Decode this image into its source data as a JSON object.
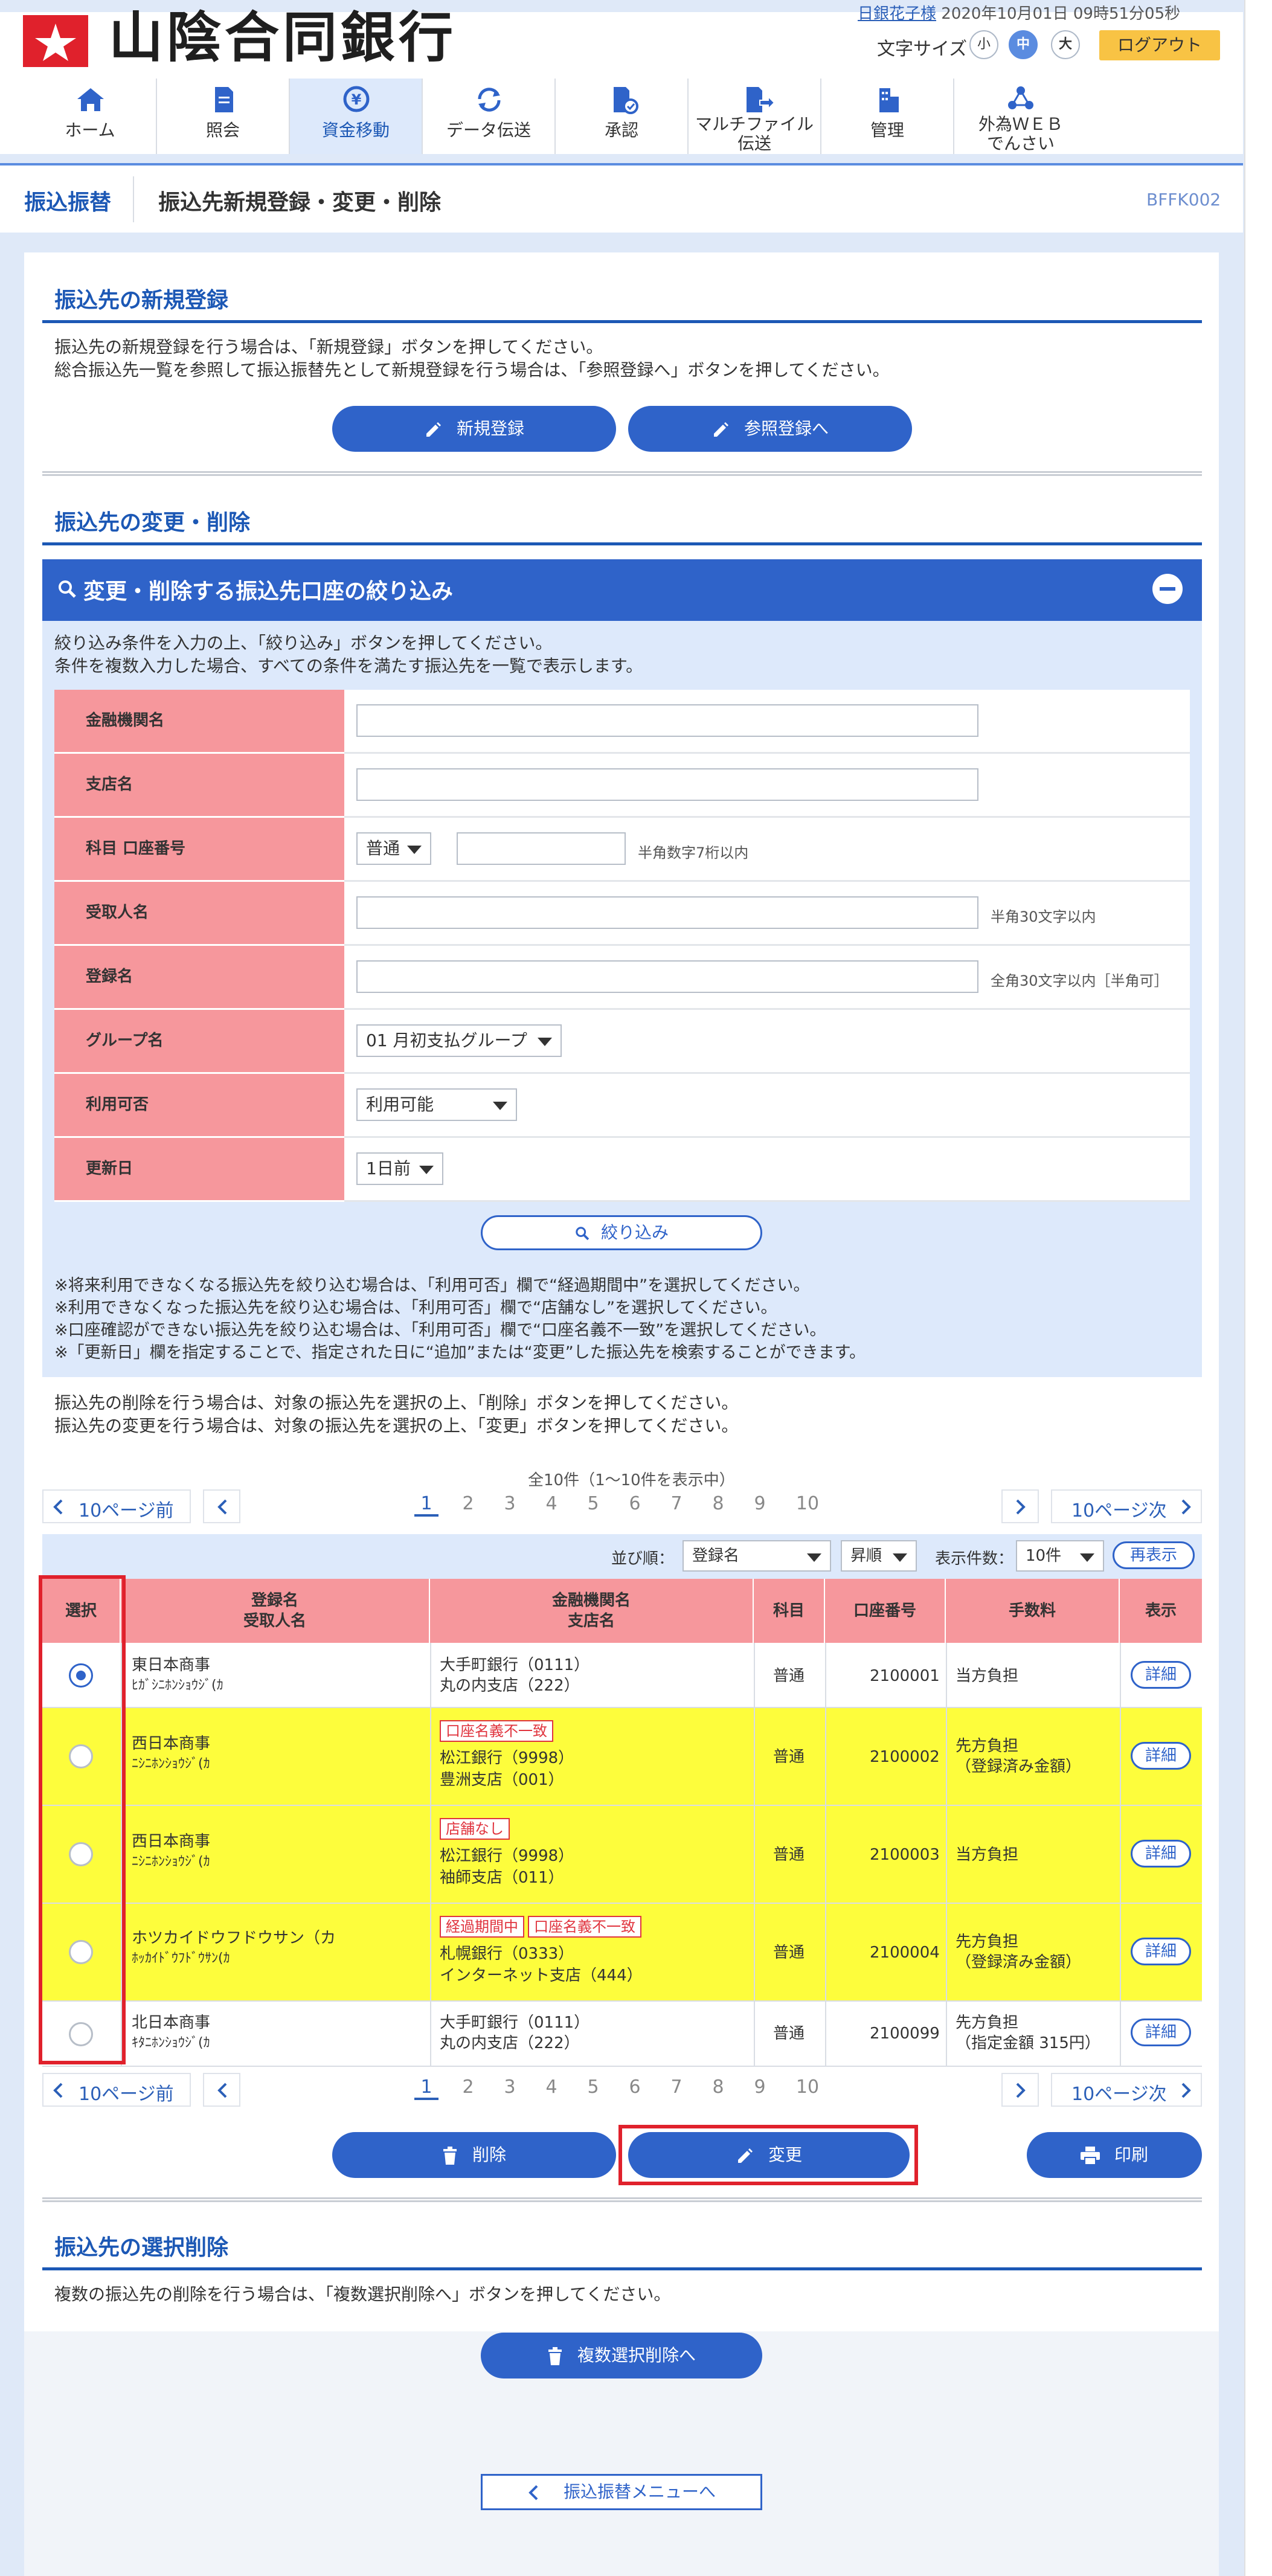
{
  "header": {
    "bank_name": "山陰合同銀行",
    "user_line": "2020年10月01日 09時51分05秒",
    "user_name": "日銀花子様",
    "font_size_label": "文字サイズ",
    "font_sizes": [
      "小",
      "中",
      "大"
    ],
    "logout": "ログアウト",
    "nav": [
      {
        "label": "ホーム",
        "icon": "home-icon"
      },
      {
        "label": "照会",
        "icon": "document-icon"
      },
      {
        "label": "資金移動",
        "icon": "yen-transfer-icon"
      },
      {
        "label": "データ伝送",
        "icon": "sync-icon"
      },
      {
        "label": "承認",
        "icon": "approve-document-icon"
      },
      {
        "label": "マルチファイル伝送",
        "label2": "伝送",
        "label1": "マルチファイル",
        "icon": "file-send-icon"
      },
      {
        "label": "管理",
        "icon": "building-icon"
      },
      {
        "label1": "外為ＷＥＢ",
        "label2": "でんさい",
        "icon": "network-icon"
      }
    ]
  },
  "titlebar": {
    "crumb": "振込振替",
    "title": "振込先新規登録・変更・削除",
    "screen_id": "BFFK002"
  },
  "new_section": {
    "heading": "振込先の新規登録",
    "text1": "振込先の新規登録を行う場合は、「新規登録」ボタンを押してください。",
    "text2": "総合振込先一覧を参照して振込振替先として新規登録を行う場合は、「参照登録へ」ボタンを押してください。",
    "btn_new": "新規登録",
    "btn_ref": "参照登録へ"
  },
  "change_section": {
    "heading": "振込先の変更・削除",
    "filter_title": "変更・削除する振込先口座の絞り込み",
    "filter_text1": "絞り込み条件を入力の上、「絞り込み」ボタンを押してください。",
    "filter_text2": "条件を複数入力した場合、すべての条件を満たす振込先を一覧で表示します。",
    "fields": {
      "bank": "金融機関名",
      "branch": "支店名",
      "account": "科目 口座番号",
      "account_type": "普通",
      "account_hint": "半角数字7桁以内",
      "payee": "受取人名",
      "payee_hint": "半角30文字以内",
      "reg_name": "登録名",
      "reg_hint": "全角30文字以内［半角可］",
      "group": "グループ名",
      "group_value": "01 月初支払グループ",
      "usable": "利用可否",
      "usable_value": "利用可能",
      "updated": "更新日",
      "updated_value": "1日前"
    },
    "filter_btn": "絞り込み",
    "notes": [
      "※将来利用できなくなる振込先を絞り込む場合は、「利用可否」欄で“経過期間中”を選択してください。",
      "※利用できなくなった振込先を絞り込む場合は、「利用可否」欄で“店舗なし”を選択してください。",
      "※口座確認ができない振込先を絞り込む場合は、「利用可否」欄で“口座名義不一致”を選択してください。",
      "※「更新日」欄を指定することで、指定された日に“追加”または“変更”した振込先を検索することができます。"
    ],
    "instr1": "振込先の削除を行う場合は、対象の振込先を選択の上、「削除」ボタンを押してください。",
    "instr2": "振込先の変更を行う場合は、対象の振込先を選択の上、「変更」ボタンを押してください。"
  },
  "pagination": {
    "summary": "全10件（1～10件を表示中）",
    "prev10": "10ページ前",
    "next10": "10ページ次",
    "pages": [
      "1",
      "2",
      "3",
      "4",
      "5",
      "6",
      "7",
      "8",
      "9",
      "10"
    ],
    "current": "1"
  },
  "toolbar": {
    "sort_label": "並び順：",
    "sort_value": "登録名",
    "order_value": "昇順",
    "count_label": "表示件数：",
    "count_value": "10件",
    "redisplay": "再表示"
  },
  "table": {
    "headers": {
      "select": "選択",
      "name1": "登録名",
      "name2": "受取人名",
      "bank1": "金融機関名",
      "bank2": "支店名",
      "type": "科目",
      "account": "口座番号",
      "fee": "手数料",
      "show": "表示"
    },
    "rows": [
      {
        "name": "東日本商事",
        "kana": "ﾋｶﾞｼﾆﾎﾝｼｮｳｼﾞ(ｶ",
        "tags": [],
        "bank": "大手町銀行（0111）",
        "branch": "丸の内支店（222）",
        "type": "普通",
        "account": "2100001",
        "fee1": "当方負担",
        "fee2": "",
        "detail": "詳細",
        "selected": true
      },
      {
        "name": "西日本商事",
        "kana": "ﾆｼﾆﾎﾝｼｮｳｼﾞ(ｶ",
        "tags": [
          "口座名義不一致"
        ],
        "bank": "松江銀行（9998）",
        "branch": "豊洲支店（001）",
        "type": "普通",
        "account": "2100002",
        "fee1": "先方負担",
        "fee2": "（登録済み金額）",
        "detail": "詳細",
        "selected": false
      },
      {
        "name": "西日本商事",
        "kana": "ﾆｼﾆﾎﾝｼｮｳｼﾞ(ｶ",
        "tags": [
          "店舗なし"
        ],
        "bank": "松江銀行（9998）",
        "branch": "袖師支店（011）",
        "type": "普通",
        "account": "2100003",
        "fee1": "当方負担",
        "fee2": "",
        "detail": "詳細",
        "selected": false
      },
      {
        "name": "ホツカイドウフドウサン（カ",
        "kana": "ﾎｯｶｲﾄﾞｳﾌﾄﾞｳｻﾝ(ｶ",
        "tags": [
          "経過期間中",
          "口座名義不一致"
        ],
        "bank": "札幌銀行（0333）",
        "branch": "インターネット支店（444）",
        "type": "普通",
        "account": "2100004",
        "fee1": "先方負担",
        "fee2": "（登録済み金額）",
        "detail": "詳細",
        "selected": false
      },
      {
        "name": "北日本商事",
        "kana": "ｷﾀﾆﾎﾝｼｮｳｼﾞ(ｶ",
        "tags": [],
        "bank": "大手町銀行（0111）",
        "branch": "丸の内支店（222）",
        "type": "普通",
        "account": "2100099",
        "fee1": "先方負担",
        "fee2": "（指定金額 315円）",
        "detail": "詳細",
        "selected": false
      }
    ]
  },
  "actions": {
    "delete": "削除",
    "change": "変更",
    "print": "印刷"
  },
  "multi_section": {
    "heading": "振込先の選択削除",
    "text": "複数の振込先の削除を行う場合は、「複数選択削除へ」ボタンを押してください。",
    "btn": "複数選択削除へ"
  },
  "back_btn": "振込振替メニューへ",
  "colors": {
    "primary": "#2f63c9",
    "label_bg": "#f6979c",
    "highlight_row": "#fdfd3c",
    "accent_red": "#e0212c"
  }
}
